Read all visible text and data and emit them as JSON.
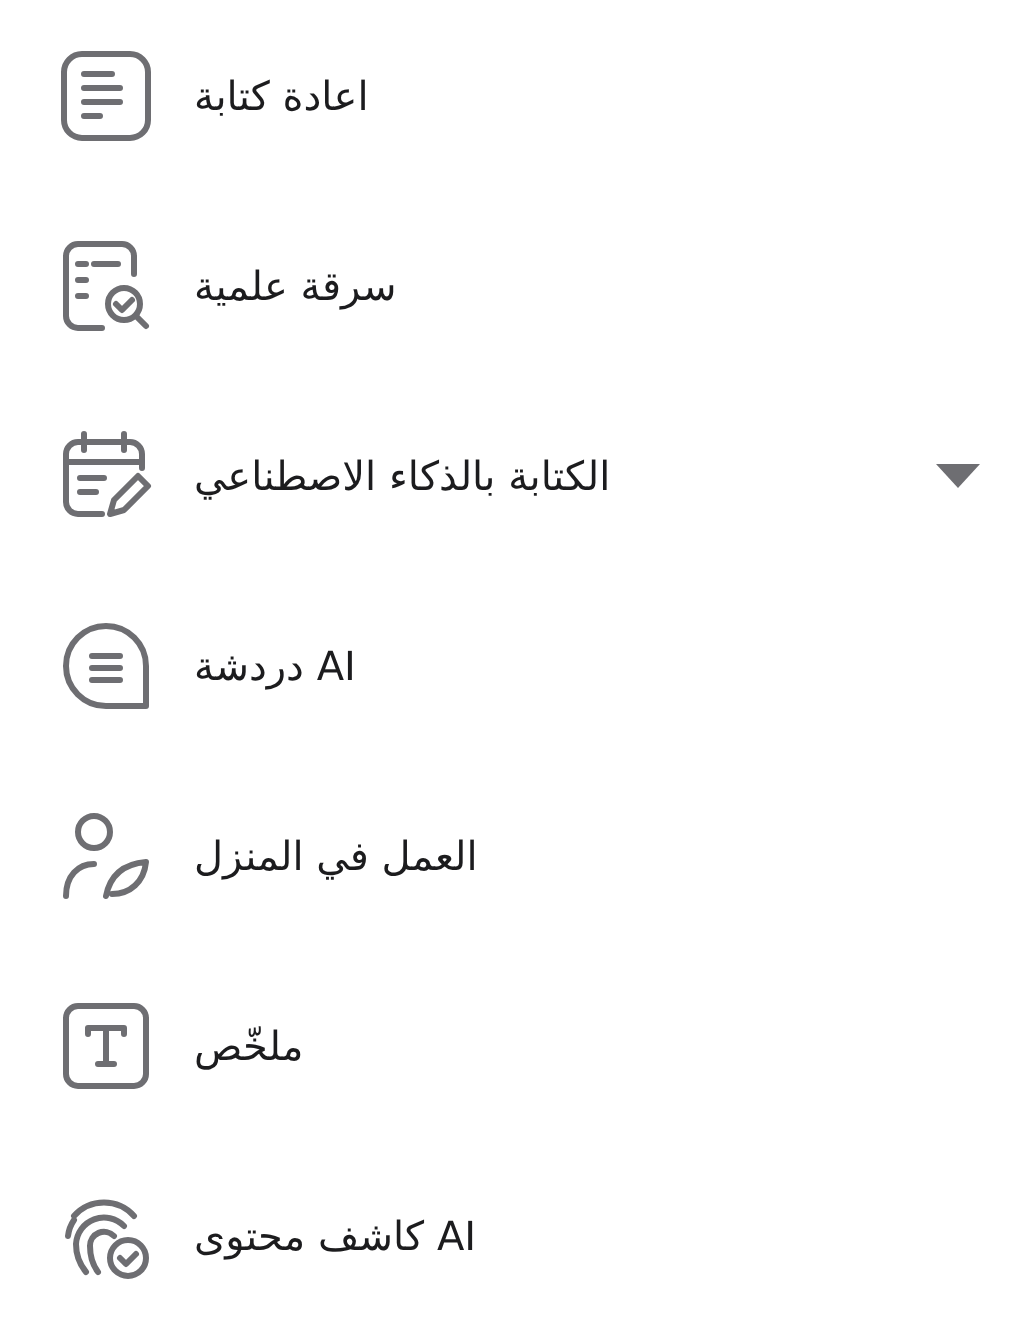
{
  "menu": {
    "items": [
      {
        "label": "اعادة كتابة",
        "kind": "lines",
        "expandable": false
      },
      {
        "label": "سرقة علمية",
        "kind": "check-doc",
        "expandable": false
      },
      {
        "label": "الكتابة بالذكاء الاصطناعي",
        "kind": "calendar-pen",
        "expandable": true
      },
      {
        "label": "AI دردشة",
        "kind": "chat",
        "expandable": false
      },
      {
        "label": "العمل في المنزل",
        "kind": "person-leaf",
        "expandable": false
      },
      {
        "label": "ملخّص",
        "kind": "letter-box",
        "expandable": false
      },
      {
        "label": "AI كاشف محتوى",
        "kind": "fingerprint",
        "expandable": false
      }
    ]
  }
}
